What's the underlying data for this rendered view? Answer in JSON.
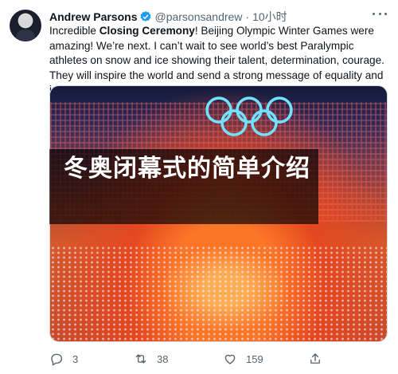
{
  "tweet": {
    "author_name": "Andrew Parsons",
    "handle": "@parsonsandrew",
    "separator": "·",
    "time": "10小时",
    "text_before": "Incredible ",
    "text_bold": "Closing Ceremony",
    "text_after": "! Beijing Olympic Winter Games were amazing! We’re next. I can’t wait to see world’s best Paralympic athletes on snow and ice showing their talent, determination, courage. They will inspire the world and send a strong message of equality and inclusion.",
    "overlay_text": "冬奥闭幕式的简单介绍"
  },
  "actions": {
    "reply_count": "3",
    "retweet_count": "38",
    "like_count": "159"
  },
  "colors": {
    "verified": "#1d9bf0",
    "secondary_text": "#536471",
    "rings": "#6fe3ff"
  },
  "icons": [
    "verified-badge-icon",
    "more-icon",
    "reply-icon",
    "retweet-icon",
    "like-icon",
    "share-icon"
  ]
}
